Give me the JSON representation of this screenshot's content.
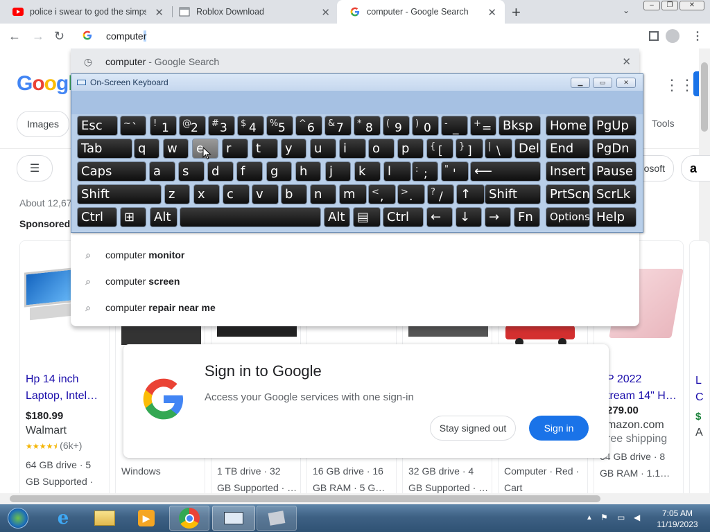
{
  "tabs": [
    {
      "title": "police i swear to god the simpsons",
      "icon": "youtube-icon"
    },
    {
      "title": "Roblox Download",
      "icon": "page-icon"
    },
    {
      "title": "computer - Google Search",
      "icon": "google-icon"
    }
  ],
  "tab_close": "✕",
  "new_tab": "+",
  "window_controls": {
    "minimize": "–",
    "restore": "❐",
    "close": "✕"
  },
  "omnibox": {
    "typed": "compute",
    "cursor_char": "r",
    "value": "computer"
  },
  "top_suggestion": {
    "text": "computer",
    "suffix": " - Google Search",
    "remove": "✕"
  },
  "suggestions": [
    {
      "prefix": "computer",
      "bold": " monitor"
    },
    {
      "prefix": "computer",
      "bold": " screen"
    },
    {
      "prefix": "computer",
      "bold": " repair near me"
    }
  ],
  "google_logo": "Google",
  "chips": {
    "images": "Images",
    "tools": "Tools",
    "microsoft": "osoft",
    "amazon": "a"
  },
  "results_count": "About 12,67",
  "sponsored": "Sponsored",
  "products": [
    {
      "title1": "Hp 14 inch",
      "title2": "Laptop, Intel…",
      "price": "$180.99",
      "store": "Walmart",
      "rating_stars": 4.5,
      "rating_count": "(6k+)",
      "spec1": "64 GB drive · 5",
      "spec2": "GB Supported · …"
    },
    {
      "spec1": "Windows"
    },
    {
      "spec1": "1 TB drive · 32",
      "spec2": "GB Supported · …"
    },
    {
      "spec1": "16 GB drive · 16",
      "spec2": "GB RAM · 5 G…"
    },
    {
      "spec1": "32 GB drive · 4",
      "spec2": "GB Supported · …"
    },
    {
      "spec1": "Computer · Red ·",
      "spec2": "Cart"
    },
    {
      "title1": "P 2022",
      "title2": "tream 14\" H…",
      "price": "279.00",
      "store": "mazon.com",
      "shipping": "ree shipping",
      "spec1": "64 GB drive · 8",
      "spec2": "GB RAM · 1.1…"
    }
  ],
  "edge_card": {
    "t1": "L",
    "t2": "C",
    "p": "$",
    "s": "A"
  },
  "osk": {
    "title": "On-Screen Keyboard",
    "rows": [
      [
        [
          "Esc"
        ],
        [
          "~",
          "`"
        ],
        [
          "!",
          "1"
        ],
        [
          "@",
          "2"
        ],
        [
          "#",
          "3"
        ],
        [
          "$",
          "4"
        ],
        [
          "%",
          "5"
        ],
        [
          "^",
          "6"
        ],
        [
          "&",
          "7"
        ],
        [
          "*",
          "8"
        ],
        [
          "(",
          "9"
        ],
        [
          ")",
          "0"
        ],
        [
          "-",
          "_"
        ],
        [
          "+",
          "="
        ],
        [
          "Bksp"
        ],
        [
          "Home"
        ],
        [
          "PgUp"
        ]
      ],
      [
        [
          "Tab"
        ],
        [
          "q"
        ],
        [
          "w"
        ],
        [
          "e"
        ],
        [
          "r"
        ],
        [
          "t"
        ],
        [
          "y"
        ],
        [
          "u"
        ],
        [
          "i"
        ],
        [
          "o"
        ],
        [
          "p"
        ],
        [
          "{",
          "["
        ],
        [
          "}",
          "]"
        ],
        [
          "|",
          "\\"
        ],
        [
          "Del"
        ],
        [
          "End"
        ],
        [
          "PgDn"
        ]
      ],
      [
        [
          "Caps"
        ],
        [
          "a"
        ],
        [
          "s"
        ],
        [
          "d"
        ],
        [
          "f"
        ],
        [
          "g"
        ],
        [
          "h"
        ],
        [
          "j"
        ],
        [
          "k"
        ],
        [
          "l"
        ],
        [
          ":",
          ";"
        ],
        [
          "\"",
          "'"
        ],
        [
          "⟵"
        ],
        [
          "Insert"
        ],
        [
          "Pause"
        ]
      ],
      [
        [
          "Shift"
        ],
        [
          "z"
        ],
        [
          "x"
        ],
        [
          "c"
        ],
        [
          "v"
        ],
        [
          "b"
        ],
        [
          "n"
        ],
        [
          "m"
        ],
        [
          "<",
          ","
        ],
        [
          ">",
          "."
        ],
        [
          "?",
          "/"
        ],
        [
          "↑"
        ],
        [
          "Shift"
        ],
        [
          "PrtScn"
        ],
        [
          "ScrLk"
        ]
      ],
      [
        [
          "Ctrl"
        ],
        [
          "⊞"
        ],
        [
          "Alt"
        ],
        [
          ""
        ],
        [
          "Alt"
        ],
        [
          "▤"
        ],
        [
          "Ctrl"
        ],
        [
          "←"
        ],
        [
          "↓"
        ],
        [
          "→"
        ],
        [
          "Fn"
        ],
        [
          "Options"
        ],
        [
          "Help"
        ]
      ]
    ]
  },
  "signin": {
    "title": "Sign in to Google",
    "subtitle": "Access your Google services with one sign-in",
    "stay_out": "Stay signed out",
    "sign_in": "Sign in"
  },
  "taskbar": {
    "time": "7:05 AM",
    "date": "11/19/2023"
  },
  "colors": {
    "accent": "#1a73e8",
    "link": "#1a0dab",
    "tabstrip": "#dee1e6",
    "osk_body": "#b9cfe9"
  }
}
